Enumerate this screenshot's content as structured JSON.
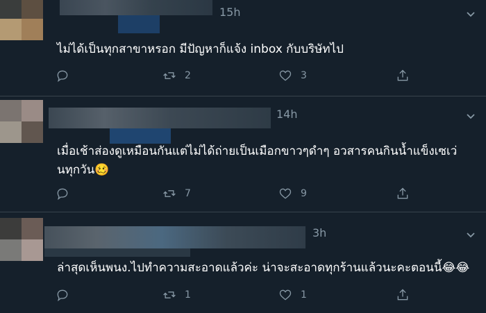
{
  "colors": {
    "background": "#15202b",
    "text": "#ffffff",
    "muted": "#8899a6",
    "divider": "#38444d"
  },
  "tweets": [
    {
      "time": "15h",
      "text": "ไม่ได้เป็นทุกสาขาหรอก มีปัญหาก็แจ้ง inbox กับบริษัทไป",
      "reply_count": "",
      "retweet_count": "2",
      "like_count": "3"
    },
    {
      "time": "14h",
      "text": "เมื่อเช้าส่องดูเหมือนกันแต่ไม่ได้ถ่ายเป็นเมือกขาวๆดำๆ อวสารคนกินน้ำแข็งเซเว่นทุกวัน🥴",
      "reply_count": "",
      "retweet_count": "7",
      "like_count": "9"
    },
    {
      "time": "3h",
      "text": "ล่าสุดเห็นพนง.ไปทำความสะอาดแล้วค่ะ น่าจะสะอาดทุกร้านแล้วนะคะตอนนี้😂😂",
      "reply_count": "",
      "retweet_count": "1",
      "like_count": "1"
    }
  ],
  "icons": {
    "reply": "reply-icon",
    "retweet": "retweet-icon",
    "like": "like-icon",
    "share": "share-icon",
    "more": "more-caret-icon"
  }
}
